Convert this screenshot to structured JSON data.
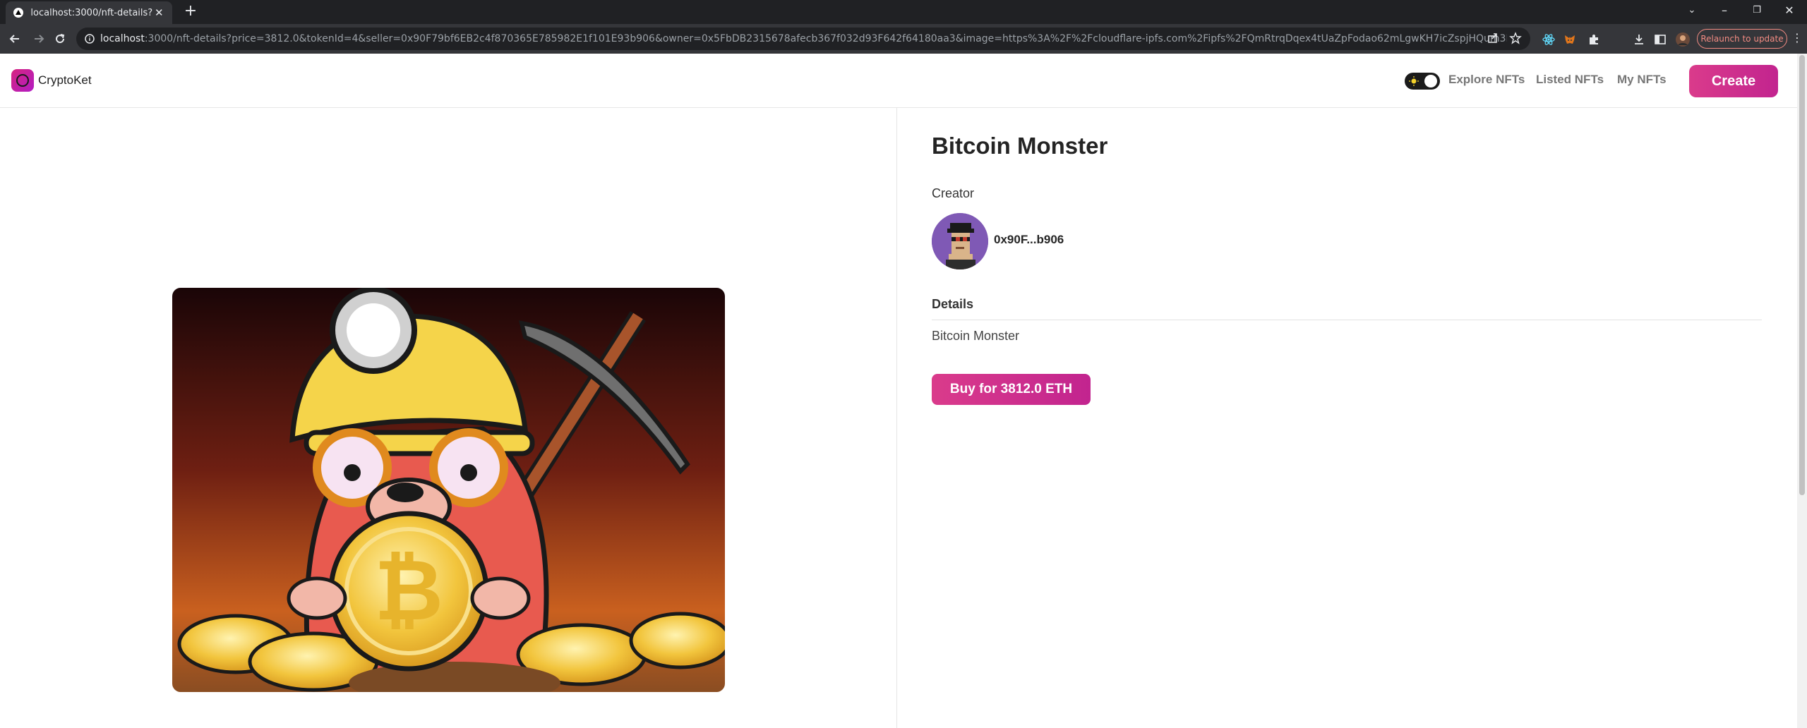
{
  "browser": {
    "tab_title": "localhost:3000/nft-details?price=",
    "url_host": "localhost",
    "url_rest": ":3000/nft-details?price=3812.0&tokenId=4&seller=0x90F79bf6EB2c4f870365E785982E1f101E93b906&owner=0x5FbDB2315678afecb367f032d93F642f64180aa3&image=https%3A%2F%2Fcloudflare-ipfs.com%2Fipfs%2FQmRtrqDqex4tUaZpFodao62mLgwKH7icZspjHQum3Mhwgw&name=Bitcoin+Monster&...",
    "relaunch_label": "Relaunch to update"
  },
  "nav": {
    "logo_text": "CryptoKet",
    "links": [
      "Explore NFTs",
      "Listed NFTs",
      "My NFTs"
    ],
    "create_label": "Create"
  },
  "nft": {
    "name": "Bitcoin Monster",
    "creator_label": "Creator",
    "creator_address": "0x90F...b906",
    "details_label": "Details",
    "description": "Bitcoin Monster",
    "buy_label": "Buy for 3812.0 ETH"
  },
  "colors": {
    "brand": "#d6247f",
    "brand_gradient_end": "#c2248f",
    "chrome_dark": "#202124",
    "chrome_mid": "#35363a"
  },
  "icons": [
    "back-icon",
    "forward-icon",
    "reload-icon",
    "site-info-icon",
    "share-icon",
    "bookmark-star-icon",
    "react-devtools-icon",
    "metamask-icon",
    "extensions-icon",
    "download-icon",
    "sidepanel-icon",
    "profile-avatar-icon",
    "sun-icon"
  ]
}
